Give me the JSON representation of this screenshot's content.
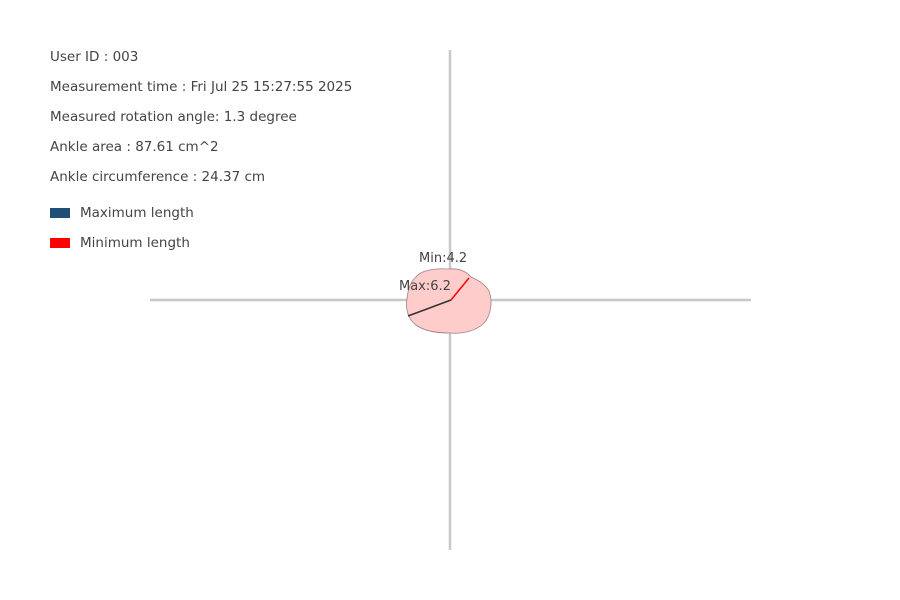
{
  "info": {
    "user_id": "User ID : 003",
    "measurement_time": "Measurement time : Fri Jul 25 15:27:55 2025",
    "rotation_angle": "Measured rotation angle: 1.3 degree",
    "ankle_area": "Ankle area : 87.61 cm^2",
    "ankle_circumference": "Ankle circumference : 24.37 cm"
  },
  "legend": {
    "max": {
      "label": "Maximum length",
      "color": "#1f4e79"
    },
    "min": {
      "label": "Minimum length",
      "color": "#ff0000"
    }
  },
  "plot": {
    "axis_color": "#c8c8c8",
    "shape_fill": "#ffcccc",
    "shape_stroke": "#a08080",
    "max_line_color": "#333333",
    "min_line_color": "#ff0000",
    "max_label": "Max:6.2",
    "min_label": "Min:4.2"
  }
}
